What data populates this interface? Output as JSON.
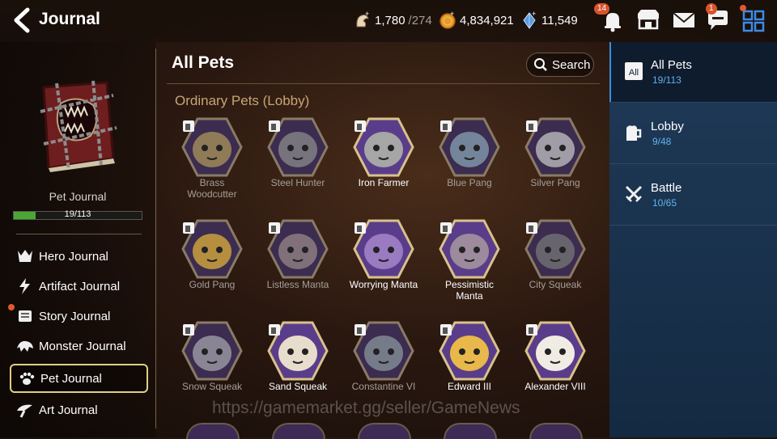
{
  "header": {
    "title": "Journal",
    "stamina": "1,780",
    "stamina_max": "/274",
    "gold": "4,834,921",
    "crystals": "11,549",
    "notifications_badge": "14",
    "mail_badge": "1",
    "icons": [
      "back-arrow-icon",
      "stamina-icon",
      "gold-coin-icon",
      "crystal-icon",
      "bell-icon",
      "shop-icon",
      "mail-icon",
      "chat-icon",
      "menu-grid-icon"
    ]
  },
  "left_panel": {
    "journal_name": "Pet Journal",
    "progress_text": "19/113",
    "progress_fraction": 0.168,
    "nav": [
      {
        "label": "Hero Journal",
        "icon": "hero-icon"
      },
      {
        "label": "Artifact Journal",
        "icon": "artifact-icon"
      },
      {
        "label": "Story Journal",
        "icon": "scroll-icon"
      },
      {
        "label": "Monster Journal",
        "icon": "monster-icon"
      },
      {
        "label": "Pet Journal",
        "icon": "paw-icon"
      },
      {
        "label": "Art Journal",
        "icon": "art-icon"
      }
    ]
  },
  "main": {
    "title": "All Pets",
    "search_label": "Search",
    "section_label": "Ordinary Pets (Lobby)",
    "pets": [
      {
        "name": "Brass\nWoodcutter",
        "unlocked": false,
        "color": "#b09a5a"
      },
      {
        "name": "Steel Hunter",
        "unlocked": false,
        "color": "#8f8f8f"
      },
      {
        "name": "Iron Farmer",
        "unlocked": true,
        "color": "#a6a6a6"
      },
      {
        "name": "Blue Pang",
        "unlocked": false,
        "color": "#8aa7b8"
      },
      {
        "name": "Silver Pang",
        "unlocked": false,
        "color": "#c9c9c9"
      },
      {
        "name": "Gold Pang",
        "unlocked": false,
        "color": "#e5b43a"
      },
      {
        "name": "Listless Manta",
        "unlocked": false,
        "color": "#9a8a8a"
      },
      {
        "name": "Worrying Manta",
        "unlocked": true,
        "color": "#9a7ac0"
      },
      {
        "name": "Pessimistic\nManta",
        "unlocked": true,
        "color": "#9d8a9d"
      },
      {
        "name": "City Squeak",
        "unlocked": false,
        "color": "#7a7a7a"
      },
      {
        "name": "Snow Squeak",
        "unlocked": false,
        "color": "#a8a8b0"
      },
      {
        "name": "Sand Squeak",
        "unlocked": true,
        "color": "#e8ddcc"
      },
      {
        "name": "Constantine VI",
        "unlocked": false,
        "color": "#8e9aa0"
      },
      {
        "name": "Edward III",
        "unlocked": true,
        "color": "#e8b84a"
      },
      {
        "name": "Alexander VIII",
        "unlocked": true,
        "color": "#f0ece4"
      }
    ]
  },
  "right_panel": {
    "tabs": [
      {
        "label": "All Pets",
        "count": "19/113",
        "icon": "all-icon",
        "icon_text": "All"
      },
      {
        "label": "Lobby",
        "count": "9/48",
        "icon": "mug-icon"
      },
      {
        "label": "Battle",
        "count": "10/65",
        "icon": "crossed-swords-icon"
      }
    ]
  },
  "watermark": "https://gamemarket.gg/seller/GameNews"
}
